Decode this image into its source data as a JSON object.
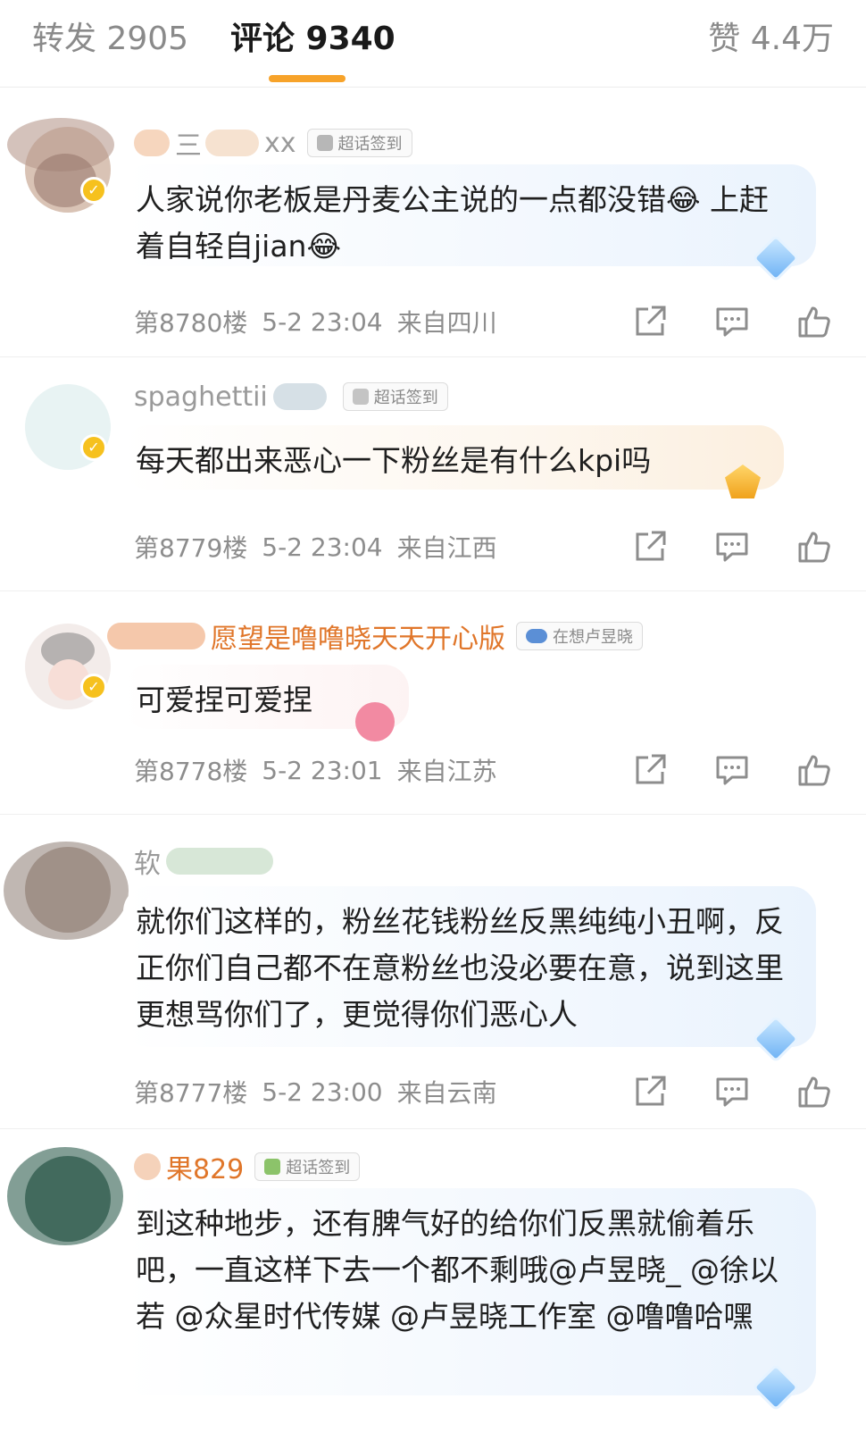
{
  "tabs": {
    "repost": "转发 2905",
    "comments": "评论 9340",
    "likes": "赞 4.4万",
    "accent": "#f7a32a"
  },
  "comments": [
    {
      "username": "三",
      "username_suffix": "xx",
      "tag": "超话签到",
      "text": "人家说你老板是丹麦公主说的一点都没错😂 上赶着自轻自jian😂",
      "floor": "第8780楼",
      "time": "5-2 23:04",
      "location": "来自四川"
    },
    {
      "username": "spaghettii",
      "tag": "超话签到",
      "text": "每天都出来恶心一下粉丝是有什么kpi吗",
      "floor": "第8779楼",
      "time": "5-2 23:04",
      "location": "来自江西"
    },
    {
      "username": "愿望是噜噜晓天天开心版",
      "tag": "在想卢昱晓",
      "text": "可爱捏可爱捏",
      "floor": "第8778楼",
      "time": "5-2 23:01",
      "location": "来自江苏"
    },
    {
      "username": "软",
      "text": "就你们这样的，粉丝花钱粉丝反黑纯纯小丑啊，反正你们自己都不在意粉丝也没必要在意，说到这里更想骂你们了，更觉得你们恶心人",
      "floor": "第8777楼",
      "time": "5-2 23:00",
      "location": "来自云南"
    },
    {
      "username": "果829",
      "tag": "超话签到",
      "text": "到这种地步，还有脾气好的给你们反黑就偷着乐吧，一直这样下去一个都不剩哦@卢昱晓_ @徐以若 @众星时代传媒 @卢昱晓工作室 @噜噜哈嘿"
    }
  ],
  "icons": {
    "share": "share-icon",
    "comment": "comment-icon",
    "like": "like-icon",
    "verified": "verified-badge-icon"
  }
}
